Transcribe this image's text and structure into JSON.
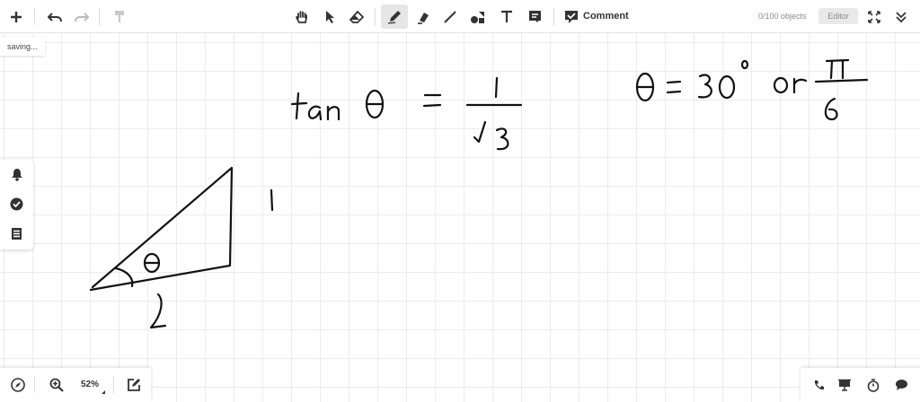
{
  "toolbar": {
    "tools": [
      {
        "name": "add-icon"
      },
      {
        "name": "undo-icon"
      },
      {
        "name": "redo-icon"
      },
      {
        "name": "format-painter-icon"
      },
      {
        "name": "hand-icon"
      },
      {
        "name": "pointer-icon"
      },
      {
        "name": "eraser-icon"
      },
      {
        "name": "pen-icon",
        "active": true
      },
      {
        "name": "highlighter-icon"
      },
      {
        "name": "line-icon"
      },
      {
        "name": "shapes-icon"
      },
      {
        "name": "text-icon"
      },
      {
        "name": "note-icon"
      }
    ],
    "comment_label": "Comment",
    "objects_count": "0/100 objects",
    "editor_label": "Editor"
  },
  "status": {
    "saving": "saving..."
  },
  "side_panel": {
    "icons": [
      "bell-icon",
      "check-circle-icon",
      "list-icon"
    ]
  },
  "bottom_left": {
    "zoom": "52%"
  },
  "bottom_right": {
    "icons": [
      "phone-icon",
      "presentation-icon",
      "timer-icon",
      "chat-icon"
    ]
  },
  "colors": {
    "accent": "#333333",
    "grid": "#ececec",
    "ink": "#111111"
  }
}
